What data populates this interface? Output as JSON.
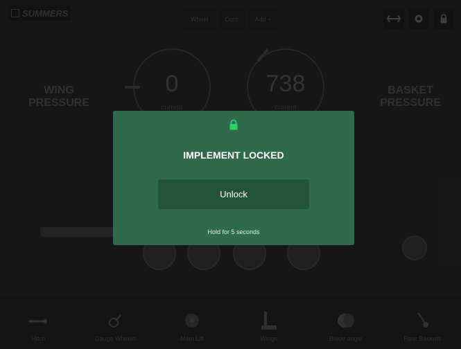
{
  "header": {
    "logo_text": "SUMMERS",
    "mode_tabs": [
      "Wheel",
      "Cont",
      "Add +"
    ]
  },
  "pressures": {
    "wing_label": "WING\nPRESSURE",
    "basket_label": "BASKET\nPRESSURE"
  },
  "gauges": [
    {
      "value": "0",
      "sub": "current"
    },
    {
      "value": "738",
      "sub": "current"
    }
  ],
  "modal": {
    "title": "IMPLEMENT LOCKED",
    "button_label": "Unlock",
    "hint": "Hold for 5 seconds",
    "lock_color": "#29d36a"
  },
  "toolbar": {
    "items": [
      {
        "label": "Hitch",
        "icon": "hitch-icon"
      },
      {
        "label": "Gauge Wheels",
        "icon": "gauge-wheel-icon"
      },
      {
        "label": "Main Lift",
        "icon": "main-lift-icon"
      },
      {
        "label": "Wings",
        "icon": "wings-icon"
      },
      {
        "label": "Blade angle",
        "icon": "blade-angle-icon"
      },
      {
        "label": "Rear Baskets",
        "icon": "rear-baskets-icon"
      }
    ]
  },
  "colors": {
    "modal_background": "#2f6a4b",
    "button_background": "#24533b",
    "app_background": "#1b1b1b"
  }
}
